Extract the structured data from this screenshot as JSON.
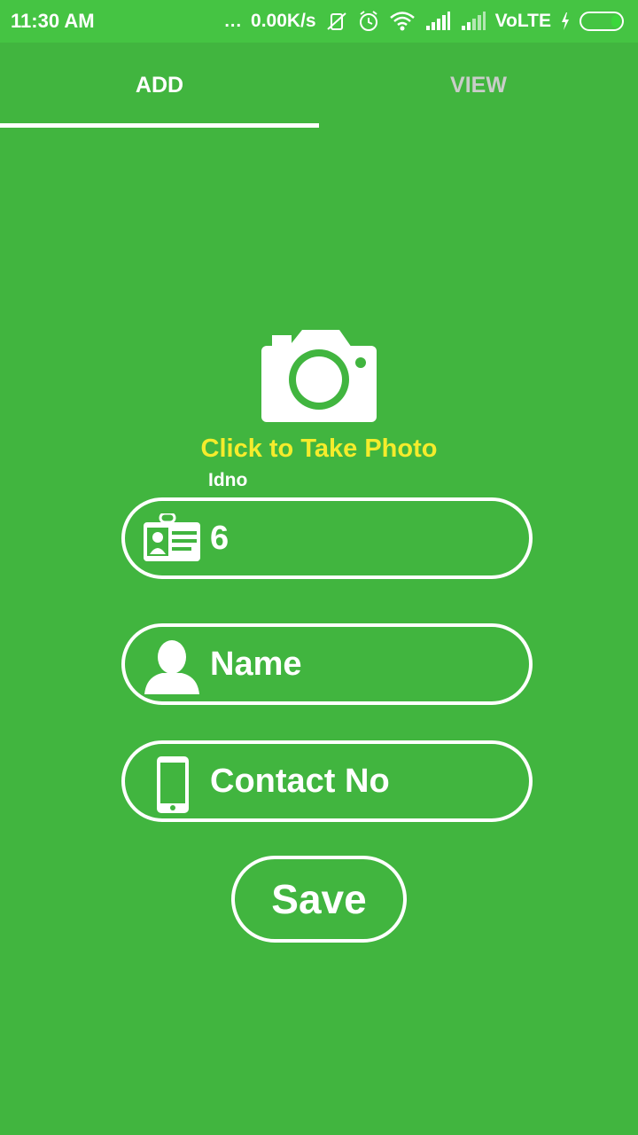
{
  "status_bar": {
    "time": "11:30 AM",
    "dots": "...",
    "speed": "0.00K/s",
    "network": "VoLTE",
    "icons": [
      "mute-icon",
      "alarm-icon",
      "wifi-icon",
      "signal-icon",
      "signal-icon",
      "charging-icon",
      "battery-icon"
    ]
  },
  "tabs": [
    {
      "label": "ADD",
      "selected": true
    },
    {
      "label": "VIEW",
      "selected": false
    }
  ],
  "camera": {
    "icon": "camera-icon",
    "label": "Click to Take Photo"
  },
  "form": {
    "idno_caption": "Idno",
    "idno_value": "6",
    "name_placeholder": "Name",
    "contact_placeholder": "Contact No",
    "save_label": "Save"
  },
  "colors": {
    "background": "#41b53f",
    "status_bar": "#45c443",
    "photo_label": "#f4ec2c",
    "inactive_tab": "#c9cdc9"
  }
}
